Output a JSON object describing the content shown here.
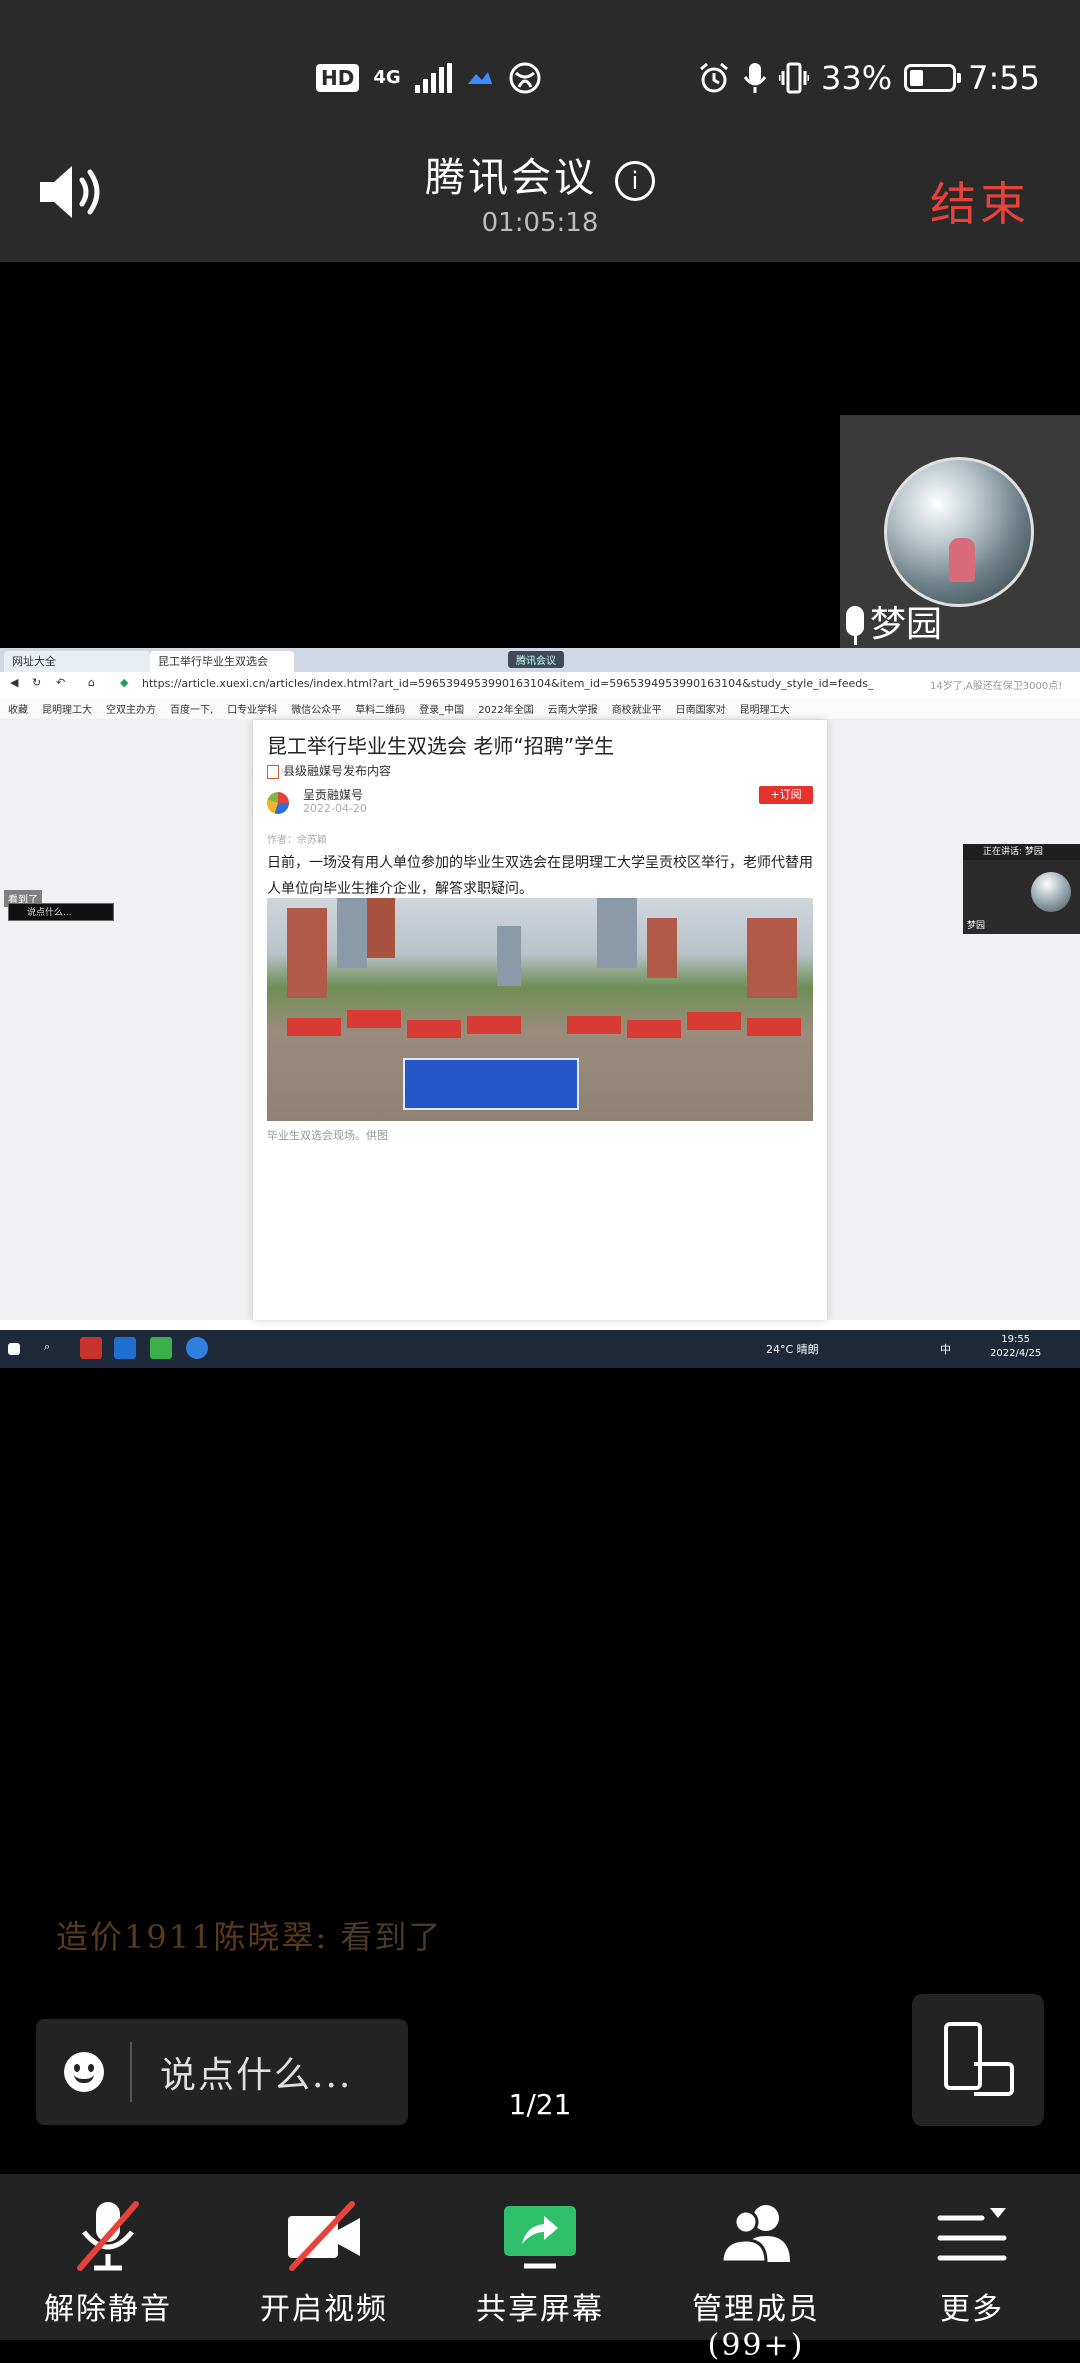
{
  "status_bar": {
    "hd": "HD",
    "network": "4G",
    "battery_percent": "33%",
    "battery_level": 0.33,
    "time": "7:55"
  },
  "header": {
    "title": "腾讯会议",
    "duration": "01:05:18",
    "end_label": "结束",
    "speaker_icon": "speaker-icon",
    "info_icon": "info-icon"
  },
  "participant_tile": {
    "name": "梦园"
  },
  "shared_screen": {
    "tabs": [
      "网址大全",
      "昆工举行毕业生双选会"
    ],
    "meeting_pill": "腾讯会议",
    "url": "https://article.xuexi.cn/articles/index.html?art_id=5965394953990163104&item_id=5965394953990163104&study_style_id=feeds_",
    "search_hint": "14岁了,A股还在保卫3000点!",
    "bookmarks": [
      "收藏",
      "昆明理工大",
      "空双主办方",
      "百度一下,",
      "口专业学科",
      "微信公众平",
      "草料二维码",
      "登录_中国",
      "2022年全国",
      "云南大学报",
      "商校就业平",
      "日南国家对",
      "昆明理工大"
    ],
    "article": {
      "title": "昆工举行毕业生双选会 老师“招聘”学生",
      "source": "县级融媒号发布内容",
      "publisher": "呈贡融媒号",
      "date": "2022-04-20",
      "subscribe": "+订阅",
      "author": "作者：佘苏颖",
      "body": "日前，一场没有用人单位参加的毕业生双选会在昆明理工大学呈贡校区举行，老师代替用人单位向毕业生推介企业，解答求职疑问。",
      "caption": "毕业生双选会现场。供图"
    },
    "mini_speaker": {
      "label": "正在讲话: 梦园",
      "name": "梦园"
    },
    "mini_chat": {
      "message": "看到了",
      "input_placeholder": "说点什么..."
    },
    "taskbar": {
      "weather": "24°C 晴朗",
      "ime": "中",
      "clock_time": "19:55",
      "clock_date": "2022/4/25"
    }
  },
  "chat": {
    "sender": "造价1911陈晓翠:",
    "message": "看到了",
    "input_placeholder": "说点什么..."
  },
  "page_indicator": "1/21",
  "controls": [
    {
      "label": "解除静音",
      "icon": "mic-muted-icon"
    },
    {
      "label": "开启视频",
      "icon": "video-off-icon"
    },
    {
      "label": "共享屏幕",
      "icon": "share-screen-icon"
    },
    {
      "label": "管理成员(99+)",
      "icon": "members-icon"
    },
    {
      "label": "更多",
      "icon": "more-menu-icon"
    }
  ],
  "colors": {
    "end_red": "#e8433b",
    "share_green": "#2fbf6b",
    "mute_slash": "#e8433b"
  }
}
